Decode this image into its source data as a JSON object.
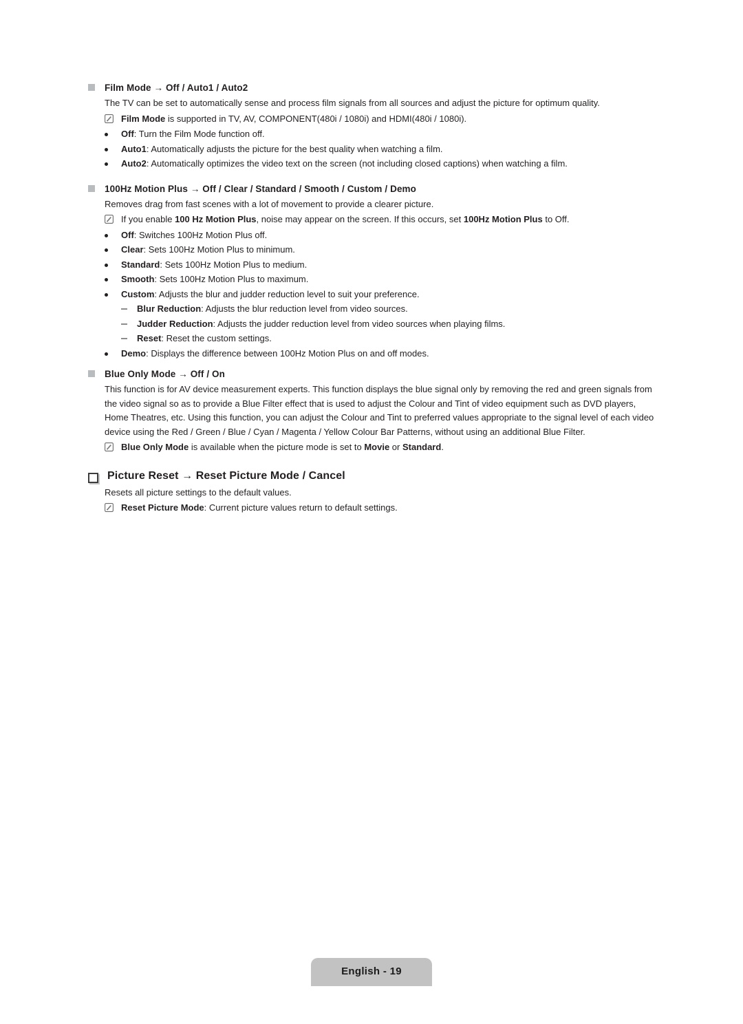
{
  "document": {
    "language_page": "English - 19"
  },
  "sections": [
    {
      "id": "film-mode",
      "bullet": "square",
      "heading": "Film Mode → Off / Auto1 / Auto2",
      "intro": "The TV can be set to automatically sense and process film signals from all sources and adjust the picture for optimum quality.",
      "note": {
        "icon": "note-pencil-icon",
        "lead": "Film Mode",
        "rest": " is supported in TV, AV, COMPONENT(480i / 1080i) and HDMI(480i / 1080i)."
      },
      "items": [
        {
          "term": "Off",
          "desc": ": Turn the Film Mode function off."
        },
        {
          "term": "Auto1",
          "desc": ": Automatically adjusts the picture for the best quality when watching a film."
        },
        {
          "term": "Auto2",
          "desc": ": Automatically optimizes the video text on the screen (not including closed captions) when watching a film."
        }
      ]
    },
    {
      "id": "motion-plus",
      "bullet": "square",
      "heading": "100Hz Motion Plus → Off / Clear / Standard / Smooth / Custom / Demo",
      "intro": "Removes drag from fast scenes with a lot of movement to provide a clearer picture.",
      "note": {
        "icon": "note-pencil-icon",
        "part1": "If you enable ",
        "bold1": "100 Hz Motion Plus",
        "part2": ", noise may appear on the screen. If this occurs, set ",
        "bold2": "100Hz Motion Plus",
        "part3": " to Off."
      },
      "items": [
        {
          "term": "Off",
          "desc": ": Switches 100Hz Motion Plus off."
        },
        {
          "term": "Clear",
          "desc": ": Sets 100Hz Motion Plus to minimum."
        },
        {
          "term": "Standard",
          "desc": ": Sets 100Hz Motion Plus to medium."
        },
        {
          "term": "Smooth",
          "desc": ": Sets 100Hz Motion Plus to maximum."
        },
        {
          "term": "Custom",
          "desc": ": Adjusts the blur and judder reduction level to suit your preference."
        }
      ],
      "subitems": [
        {
          "term": "Blur Reduction",
          "desc": ": Adjusts the blur reduction level from video sources."
        },
        {
          "term": "Judder Reduction",
          "desc": ": Adjusts the judder reduction level from video sources when playing films."
        },
        {
          "term": "Reset",
          "desc": ": Reset the custom settings."
        }
      ],
      "last_item": {
        "term": "Demo",
        "desc": ": Displays the difference between 100Hz Motion Plus on and off modes."
      }
    },
    {
      "id": "blue-only-mode",
      "bullet": "square",
      "heading": "Blue Only Mode → Off / On",
      "intro": "This function is for AV device measurement experts. This function displays the blue signal only by removing the red and green signals from the video signal so as to provide a Blue Filter effect that is used to adjust the Colour and Tint of video equipment such as DVD players, Home Theatres, etc. Using this function, you can adjust the Colour and Tint to preferred values appropriate to the signal level of each video device using the Red / Green / Blue / Cyan / Magenta / Yellow Colour Bar Patterns, without using an additional Blue Filter.",
      "note": {
        "icon": "note-pencil-icon",
        "bold1": "Blue Only Mode",
        "part2": " is available when the picture mode is set to ",
        "bold2": "Movie",
        "part3": " or ",
        "bold3": "Standard",
        "part4": "."
      }
    },
    {
      "id": "picture-reset",
      "bullet": "box",
      "heading": "Picture Reset → Reset Picture Mode / Cancel",
      "intro": "Resets all picture settings to the default values.",
      "note": {
        "icon": "note-pencil-icon",
        "bold1": "Reset Picture Mode",
        "part2": ": Current picture values return to default settings."
      }
    }
  ],
  "colors": {
    "text": "#231f20",
    "bullet_square": "#b9bcbe",
    "dash": "#8d8d8d",
    "footer_tab": "#c2c2c2"
  }
}
